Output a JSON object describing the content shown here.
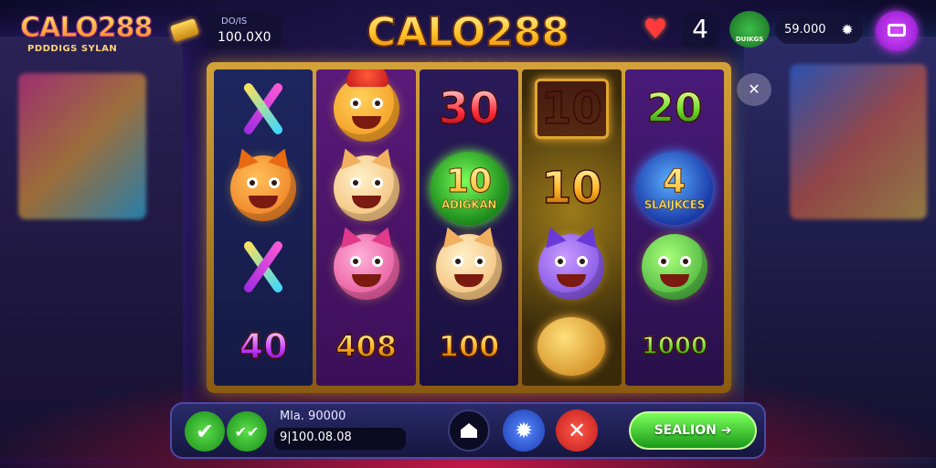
{
  "header": {
    "logo": "CALO288",
    "logo_sub": "PDDDIGS SYLAN",
    "balance_label": "DO/IS",
    "balance_value": "100.0X0",
    "title": "CALO288",
    "stars": "★★★★★★",
    "lives": "4",
    "shop_label": "DUIKGS",
    "coins": "59.000"
  },
  "reels": {
    "r0": {
      "bottom": "40"
    },
    "r1": {
      "bottom": "408"
    },
    "r2": {
      "top": "30",
      "orb_big": "10",
      "orb_small": "ADIGKAN",
      "bottom": "100"
    },
    "r3": {
      "top": "10",
      "mid": "10"
    },
    "r4": {
      "top": "20",
      "orb_big": "4",
      "orb_small": "SLAIJKCES",
      "bottom": "1000"
    }
  },
  "controls": {
    "bet_label": "Mla. 90000",
    "bet_value": "9|100.08.08",
    "spin_label": "SEALION ➔"
  },
  "icons": {
    "heart": "heart-icon",
    "mute": "mute-icon",
    "gear": "gear-icon",
    "home": "home-icon",
    "close": "close-icon",
    "check": "check-icon",
    "menu": "menu-icon"
  }
}
